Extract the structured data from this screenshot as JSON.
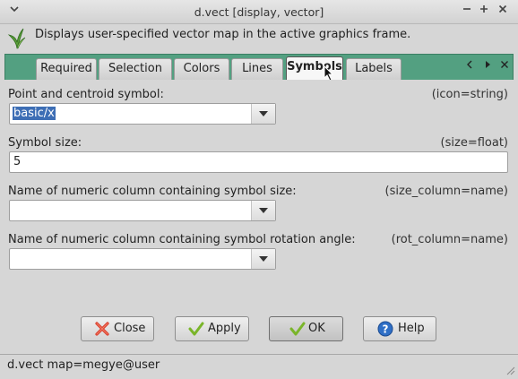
{
  "window": {
    "title": "d.vect [display, vector]",
    "description": "Displays user-specified vector map in the active graphics frame."
  },
  "tabs": [
    {
      "label": "Required"
    },
    {
      "label": "Selection"
    },
    {
      "label": "Colors"
    },
    {
      "label": "Lines"
    },
    {
      "label": "Symbols",
      "active": true
    },
    {
      "label": "Labels"
    }
  ],
  "fields": {
    "symbol": {
      "label": "Point and centroid symbol:",
      "key": "(icon=string)",
      "value": "basic/x"
    },
    "size": {
      "label": "Symbol size:",
      "key": "(size=float)",
      "value": "5"
    },
    "size_column": {
      "label": "Name of numeric column containing symbol size:",
      "key": "(size_column=name)",
      "value": ""
    },
    "rot_column": {
      "label": "Name of numeric column containing symbol rotation angle:",
      "key": "(rot_column=name)",
      "value": ""
    }
  },
  "buttons": {
    "close": "Close",
    "apply": "Apply",
    "ok": "OK",
    "help": "Help"
  },
  "status": {
    "command": "d.vect map=megye@user"
  },
  "colors": {
    "tab_strip": "#53a081",
    "selection": "#3d6eb5",
    "help_icon": "#2f6fc6",
    "check_icon": "#7ab52a",
    "close_icon": "#d93c2a"
  }
}
